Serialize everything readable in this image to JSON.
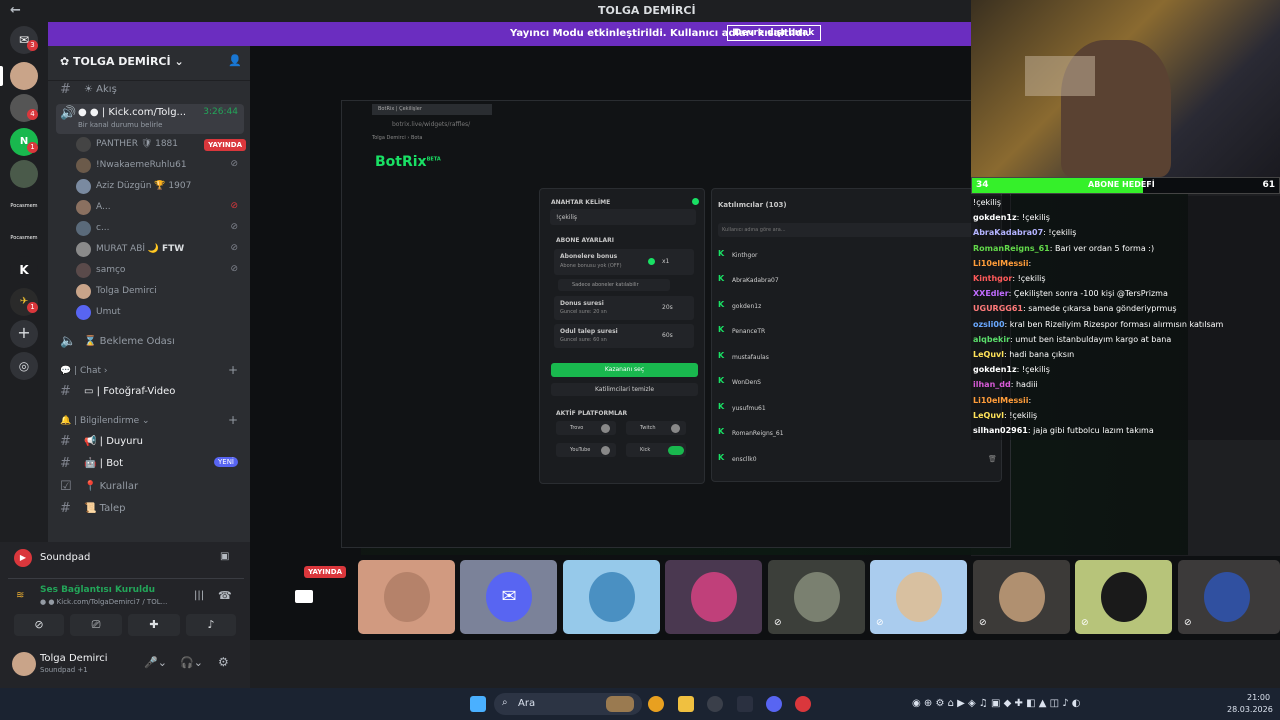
{
  "window": {
    "title": "TOLGA DEMİRCİ"
  },
  "banner": {
    "message": "Yayıncı Modu etkinleştirildi. Kullanıcı adları kısaltıldı.",
    "button": "Devre dışı bırak"
  },
  "servers": {
    "badges": [
      "3",
      "4",
      "1",
      "1"
    ],
    "labels": [
      "Pocasmem",
      "Pocasmem",
      "K"
    ]
  },
  "channels": {
    "server_name": "TOLGA DEMİRCİ",
    "akis": "Akış",
    "voice_channel": {
      "name": "| Kick.com/Tolg...",
      "timer": "3:26:44",
      "status": "Bir kanal durumu belirle"
    },
    "voice_users": [
      {
        "name": "PANTHER",
        "extra": "1881",
        "badge": "YAYINDA"
      },
      {
        "name": "!NwakaemeRuhlu61",
        "extra": ""
      },
      {
        "name": "Aziz Düzgün",
        "extra": "1907"
      },
      {
        "name": "A...",
        "extra": ""
      },
      {
        "name": "c...",
        "extra": ""
      },
      {
        "name": "MURAT ABİ",
        "extra": "FTW"
      },
      {
        "name": "samço",
        "extra": ""
      },
      {
        "name": "Tolga Demirci",
        "extra": ""
      },
      {
        "name": "Umut",
        "extra": ""
      }
    ],
    "bekleme": "Bekleme Odası",
    "chat_category": "Chat",
    "foto": "| Fotoğraf-Video",
    "bilg_category": "Bilgilendirme",
    "duyuru": "| Duyuru",
    "bot": "| Bot",
    "yeni": "YENİ",
    "kurallar": "Kurallar",
    "talep": "Talep"
  },
  "soundpad": {
    "title": "Soundpad"
  },
  "voice_panel": {
    "status": "Ses Bağlantısı Kuruldu",
    "channel": "Kick.com/TolgaDemirci7 / TOL..."
  },
  "user_panel": {
    "name": "Tolga Demirci",
    "sub": "Soundpad +1"
  },
  "botrix": {
    "tab": "BotRix | Çekilişler",
    "url": "botrix.live/widgets/raffles/",
    "crumbs": [
      "Tolga Demirci",
      "Bota"
    ],
    "logo": "BotRix",
    "beta": "BETA",
    "keyword_label": "ANAHTAR KELİME",
    "keyword_value": "!çekiliş",
    "subscriber_section": "ABONE AYARLARI",
    "bonus_label": "Abonelere bonus",
    "bonus_sub": "Abone bonusu yok (OFF)",
    "bonus_value": "x1",
    "subs_only": "Sadece aboneler katılabilir",
    "duration_label": "Donus suresi",
    "duration_sub": "Guncel sure: 20 sn",
    "duration_value": "20s",
    "claim_label": "Odul talep suresi",
    "claim_sub": "Guncel sure: 60 sn",
    "claim_value": "60s",
    "pick_winner": "Kazananı seç",
    "clear_participants": "Katilimcilari temizle",
    "platforms_label": "AKTİF PLATFORMLAR",
    "platforms": [
      "Trovo",
      "Twitch",
      "YouTube",
      "Kick"
    ],
    "participants_title": "Katılımcılar (103)",
    "search_placeholder": "Kullanıcı adına göre ara...",
    "participants": [
      "Kinthgor",
      "AbraKadabra07",
      "gokden1z",
      "PenanceTR",
      "mustafaulas",
      "WonDenS",
      "yusufmu61",
      "RomanReigns_61",
      "enscllk0"
    ]
  },
  "goal": {
    "current": "34",
    "label": "ABONE HEDEFİ",
    "target": "61",
    "progress": 0.557
  },
  "chat": [
    {
      "user": "",
      "msg": "!çekiliş",
      "color": "#ffffff"
    },
    {
      "user": "gokden1z",
      "msg": ": !çekiliş",
      "color": "#ffffff"
    },
    {
      "user": "AbraKadabra07",
      "msg": ": !çekiliş",
      "color": "#b4b4ff"
    },
    {
      "user": "RomanReigns_61",
      "msg": ": Bari ver ordan 5 forma :)",
      "color": "#62d84a"
    },
    {
      "user": "Li10elMessii",
      "msg": ":",
      "color": "#ff9c3a"
    },
    {
      "user": "Kinthgor",
      "msg": ": !çekiliş",
      "color": "#ff5a5a"
    },
    {
      "user": "XXEdler",
      "msg": ": Çekilişten sonra -100 kişi @TersPrizma",
      "color": "#c06bff"
    },
    {
      "user": "UGURGG61",
      "msg": ": samede çıkarsa bana gönderiyprmuş",
      "color": "#ff7a7a"
    },
    {
      "user": "ozsli00",
      "msg": ": kral ben Rizeliyim Rizespor forması alırmısın katılsam",
      "color": "#6aa8ff"
    },
    {
      "user": "alqbekir",
      "msg": ": umut ben istanbuldayım kargo at bana",
      "color": "#5adc6a"
    },
    {
      "user": "LeQuvl",
      "msg": ": hadi bana çıksın",
      "color": "#ffe25a"
    },
    {
      "user": "gokden1z",
      "msg": ": !çekiliş",
      "color": "#ffffff"
    },
    {
      "user": "ilhan_dd",
      "msg": ": hadiii",
      "color": "#d65ad6"
    },
    {
      "user": "Li10elMessii",
      "msg": ":",
      "color": "#ff9c3a"
    },
    {
      "user": "LeQuvl",
      "msg": ": !çekiliş",
      "color": "#ffe25a"
    },
    {
      "user": "silhan02961",
      "msg": ": jaja gibi futbolcu lazım takıma",
      "color": "#ffffff"
    }
  ],
  "tiles": {
    "live": "YAYINDA"
  },
  "taskbar": {
    "search": "Ara",
    "time": "21:00",
    "date": "28.03.2026"
  },
  "colors": {
    "accent": "#5865f2",
    "live": "#da373c",
    "brand_green": "#19e064",
    "banner": "#6b2dc0"
  }
}
